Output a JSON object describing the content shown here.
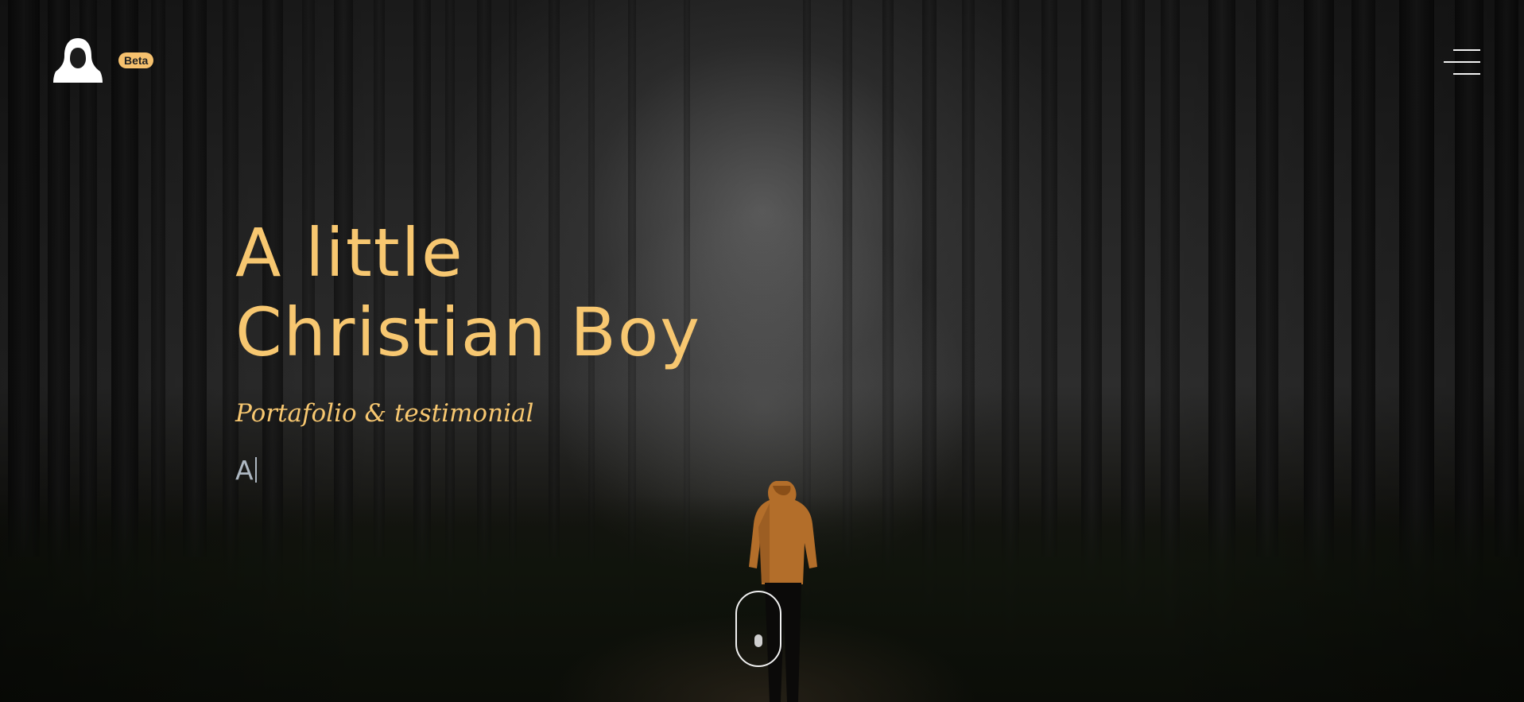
{
  "header": {
    "logo_icon": "hooded-figure-icon",
    "badge": "Beta",
    "menu_icon": "hamburger-menu-icon"
  },
  "hero": {
    "title_line1": "A little",
    "title_line2": "Christian Boy",
    "subtitle": "Portafolio & testimonial",
    "typed_text": "A",
    "scroll_icon": "mouse-scroll-icon"
  },
  "colors": {
    "accent": "#f7c770",
    "badge_bg": "#f6c16e",
    "typed_text": "#c8d4e0",
    "background": "#1a1a1a"
  }
}
